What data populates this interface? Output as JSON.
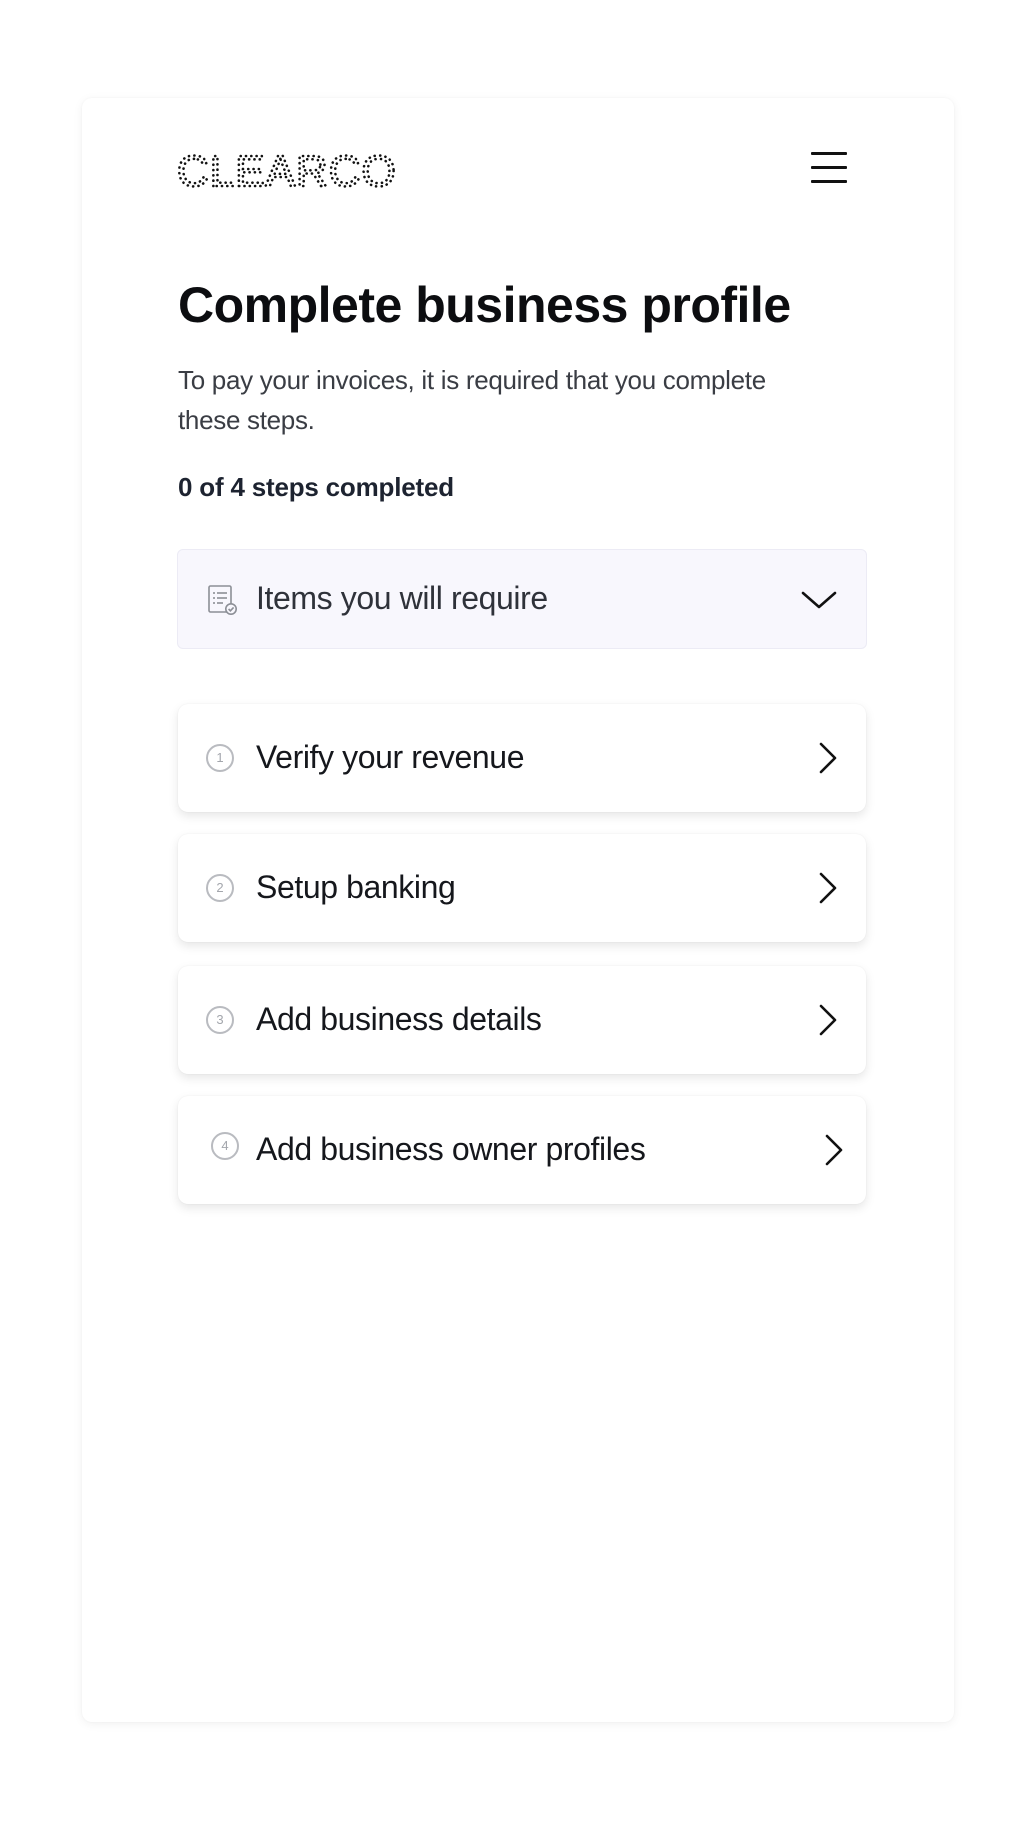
{
  "brand": {
    "logo_text": "CLEARCO",
    "menu_icon": "hamburger-menu-icon"
  },
  "page": {
    "title": "Complete business profile",
    "subtitle": "To pay your invoices, it is required that you complete these steps.",
    "progress_text": "0 of 4 steps completed"
  },
  "requirements": {
    "icon": "checklist-icon",
    "label": "Items you will require",
    "toggle_icon": "chevron-down-icon"
  },
  "steps": [
    {
      "number": "1",
      "label": "Verify your revenue"
    },
    {
      "number": "2",
      "label": "Setup banking"
    },
    {
      "number": "3",
      "label": "Add business details"
    },
    {
      "number": "4",
      "label": "Add business owner profiles"
    }
  ],
  "colors": {
    "page_background": "#ffffff",
    "requirements_background": "#f8f7fd",
    "text_primary": "#0c0d10",
    "text_secondary": "#3a3d44",
    "step_number_border": "#b9bbc0"
  }
}
